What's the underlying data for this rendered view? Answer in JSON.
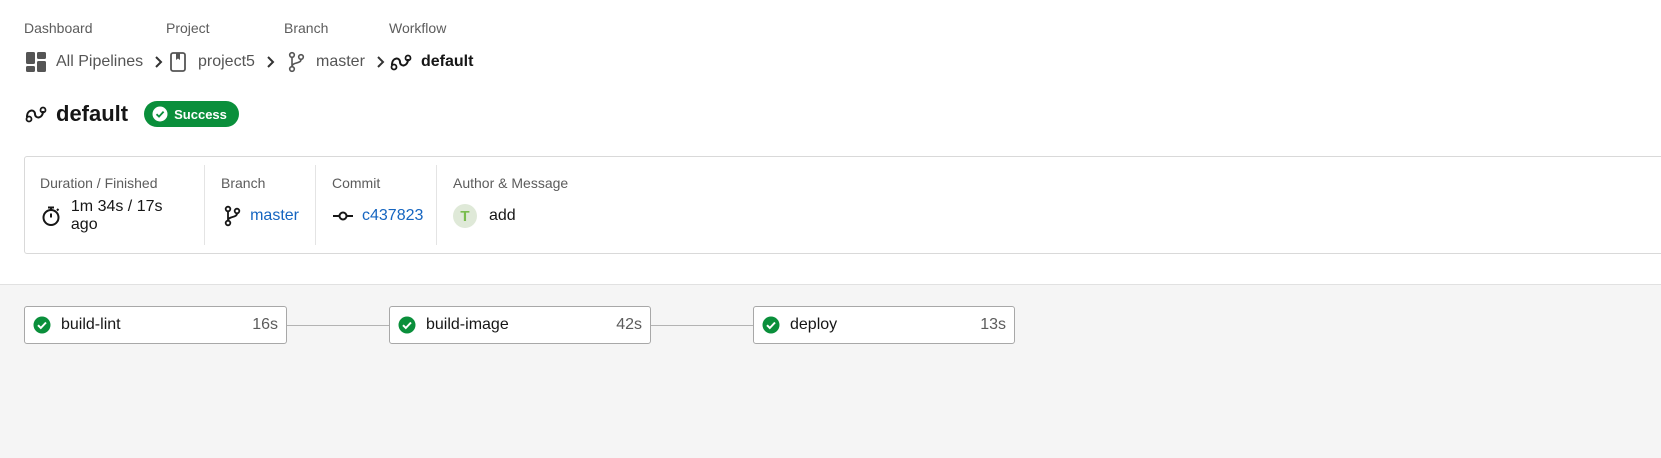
{
  "breadcrumb": {
    "dashboard": {
      "caption": "Dashboard",
      "label": "All Pipelines"
    },
    "project": {
      "caption": "Project",
      "label": "project5"
    },
    "branch": {
      "caption": "Branch",
      "label": "master"
    },
    "workflow": {
      "caption": "Workflow",
      "label": "default"
    }
  },
  "header": {
    "title": "default",
    "status": "Success"
  },
  "details": {
    "duration": {
      "label": "Duration / Finished",
      "value": "1m 34s / 17s ago"
    },
    "branch": {
      "label": "Branch",
      "value": "master"
    },
    "commit": {
      "label": "Commit",
      "value": "c437823"
    },
    "author": {
      "label": "Author & Message",
      "avatar_letter": "T",
      "message": "add"
    }
  },
  "jobs": [
    {
      "name": "build-lint",
      "duration": "16s",
      "status": "success"
    },
    {
      "name": "build-image",
      "duration": "42s",
      "status": "success"
    },
    {
      "name": "deploy",
      "duration": "13s",
      "status": "success"
    }
  ],
  "colors": {
    "success": "#0a8f3b",
    "link": "#1565c0",
    "canvas": "#f5f5f5"
  }
}
